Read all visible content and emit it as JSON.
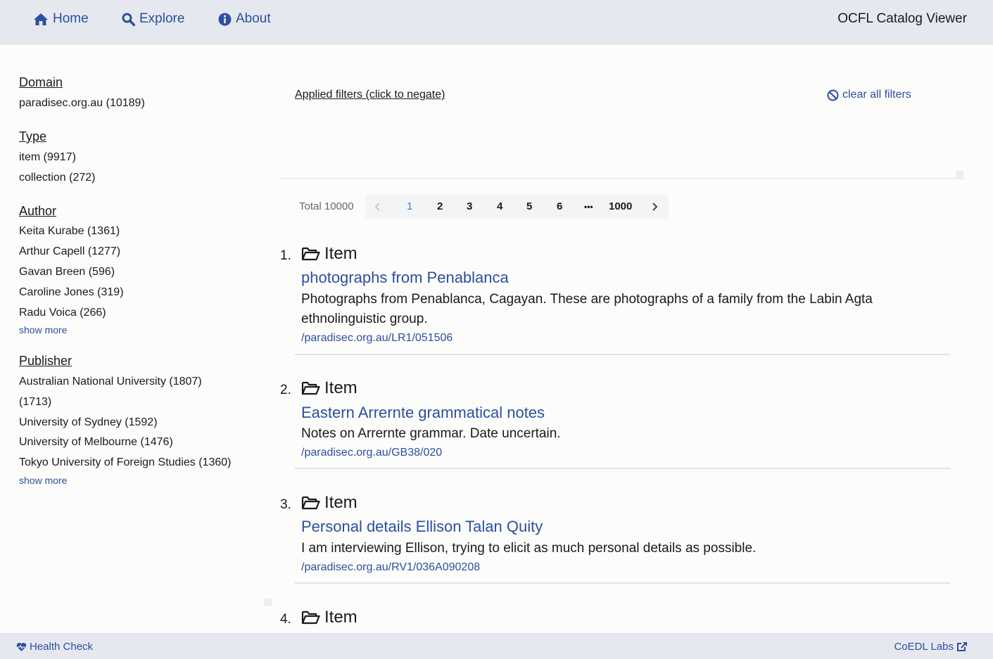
{
  "nav": {
    "home": "Home",
    "explore": "Explore",
    "about": "About",
    "title": "OCFL Catalog Viewer",
    "icons": [
      "home-icon",
      "search-icon",
      "info-icon"
    ]
  },
  "facets": {
    "domain": {
      "title": "Domain",
      "items": [
        "paradisec.org.au (10189)"
      ]
    },
    "type": {
      "title": "Type",
      "items": [
        "item (9917)",
        "collection (272)"
      ]
    },
    "author": {
      "title": "Author",
      "items": [
        "Keita Kurabe (1361)",
        "Arthur Capell (1277)",
        "Gavan Breen (596)",
        "Caroline Jones (319)",
        "Radu Voica (266)"
      ],
      "show_more": "show more"
    },
    "publisher": {
      "title": "Publisher",
      "items": [
        "Australian National University (1807)",
        "(1713)",
        "University of Sydney (1592)",
        "University of Melbourne (1476)",
        "Tokyo University of Foreign Studies (1360)"
      ],
      "show_more": "show more"
    }
  },
  "filters": {
    "applied": "Applied filters (click to negate)",
    "clear": "clear all filters"
  },
  "pagination": {
    "total": "Total 10000",
    "pages": [
      "1",
      "2",
      "3",
      "4",
      "5",
      "6",
      "•••",
      "1000"
    ],
    "current": "1"
  },
  "results": [
    {
      "num": "1.",
      "type": "Item",
      "title": "photographs from Penablanca",
      "desc": "Photographs from Penablanca, Cagayan. These are photographs of a family from the Labin Agta ethnolinguistic group.",
      "path": "/paradisec.org.au/LR1/051506"
    },
    {
      "num": "2.",
      "type": "Item",
      "title": "Eastern Arrernte grammatical notes",
      "desc": "Notes on Arrernte grammar. Date uncertain.",
      "path": "/paradisec.org.au/GB38/020"
    },
    {
      "num": "3.",
      "type": "Item",
      "title": "Personal details Ellison Talan Quity",
      "desc": "I am interviewing Ellison, trying to elicit as much personal details as possible.",
      "path": "/paradisec.org.au/RV1/036A090208"
    },
    {
      "num": "4.",
      "type": "Item"
    }
  ],
  "footer": {
    "health": "Health Check",
    "labs": "CoEDL Labs"
  },
  "colors": {
    "accent": "#2c4f9e",
    "active_page": "#3a7bd5",
    "bar_bg": "#e5e9ef"
  }
}
